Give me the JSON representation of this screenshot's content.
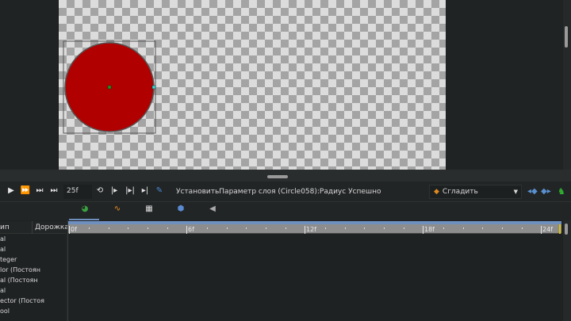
{
  "toolbar": {
    "frame": "25f",
    "status": "УстановитьПараметр слоя (Circle058):Радиус Успешно",
    "interpolation": "Сгладить"
  },
  "timeline": {
    "tabs": [
      "params",
      "curves",
      "keyframes",
      "library",
      "sound"
    ],
    "ticks": [
      "0f",
      "6f",
      "12f",
      "18f",
      "24f"
    ]
  },
  "params": {
    "headers": {
      "type": "ип",
      "track": "Дорожка"
    },
    "rows": [
      "al",
      "al",
      "teger",
      "lor (Постоян",
      "al (Постоян",
      "al",
      "ector (Постоя",
      "ool"
    ]
  },
  "colors": {
    "circle": "#b00000",
    "accent": "#6f8fbf"
  }
}
